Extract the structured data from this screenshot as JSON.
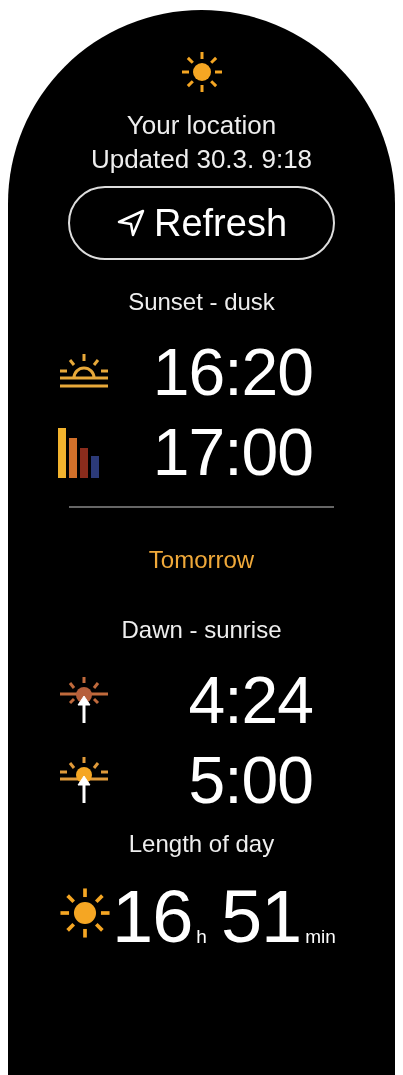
{
  "header": {
    "location": "Your location",
    "updated": "Updated 30.3. 9:18",
    "refresh_button": "Refresh"
  },
  "today": {
    "title": "Sunset - dusk",
    "times": [
      {
        "kind": "sunset",
        "time": "16:20"
      },
      {
        "kind": "dusk",
        "time": "17:00"
      }
    ]
  },
  "tomorrow": {
    "label": "Tomorrow",
    "title": "Dawn - sunrise",
    "times": [
      {
        "kind": "dawn",
        "time": "4:24"
      },
      {
        "kind": "sunrise",
        "time": "5:00"
      }
    ]
  },
  "day_length": {
    "title": "Length of day",
    "parts": [
      {
        "value": "16",
        "unit": "h"
      },
      {
        "value": "51",
        "unit": "min"
      }
    ]
  }
}
